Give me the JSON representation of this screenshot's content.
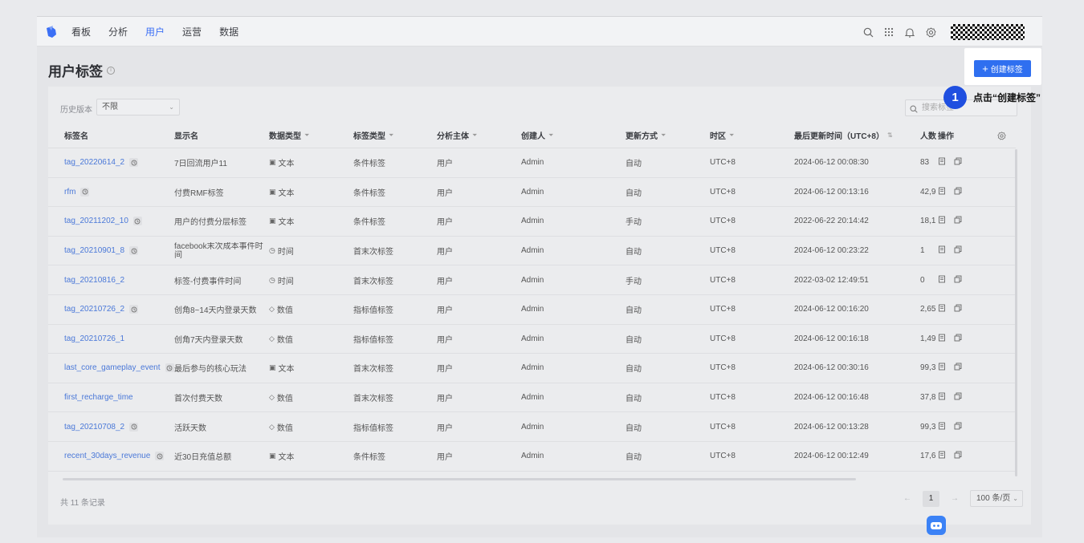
{
  "nav": {
    "items": [
      "看板",
      "分析",
      "用户",
      "运营",
      "数据"
    ],
    "active_index": 2
  },
  "page": {
    "title": "用户标签",
    "create_button": "创建标签"
  },
  "toolbar": {
    "history_label": "历史版本",
    "history_value": "不限",
    "search_placeholder": "搜索标签"
  },
  "table": {
    "headers": [
      "标签名",
      "显示名",
      "数据类型",
      "标签类型",
      "分析主体",
      "创建人",
      "更新方式",
      "时区",
      "最后更新时间（UTC+8）",
      "人数",
      "操作"
    ],
    "rows": [
      {
        "name": "tag_20220614_2",
        "history": true,
        "display": "7日回流用户11",
        "dtype": "文本",
        "dicon": "text",
        "ttype": "条件标签",
        "subject": "用户",
        "creator": "Admin",
        "update": "自动",
        "tz": "UTC+8",
        "time": "2024-06-12 00:08:30",
        "count": "83"
      },
      {
        "name": "rfm",
        "history": true,
        "display": "付费RMF标签",
        "dtype": "文本",
        "dicon": "text",
        "ttype": "条件标签",
        "subject": "用户",
        "creator": "Admin",
        "update": "自动",
        "tz": "UTC+8",
        "time": "2024-06-12 00:13:16",
        "count": "42,9"
      },
      {
        "name": "tag_20211202_10",
        "history": true,
        "display": "用户的付费分层标签",
        "dtype": "文本",
        "dicon": "text",
        "ttype": "条件标签",
        "subject": "用户",
        "creator": "Admin",
        "update": "手动",
        "tz": "UTC+8",
        "time": "2022-06-22 20:14:42",
        "count": "18,1"
      },
      {
        "name": "tag_20210901_8",
        "history": true,
        "display": "facebook末次成本事件时间",
        "dtype": "时间",
        "dicon": "time",
        "ttype": "首末次标签",
        "subject": "用户",
        "creator": "Admin",
        "update": "自动",
        "tz": "UTC+8",
        "time": "2024-06-12 00:23:22",
        "count": "1"
      },
      {
        "name": "tag_20210816_2",
        "history": false,
        "display": "标签-付费事件时间",
        "dtype": "时间",
        "dicon": "time",
        "ttype": "首末次标签",
        "subject": "用户",
        "creator": "Admin",
        "update": "手动",
        "tz": "UTC+8",
        "time": "2022-03-02 12:49:51",
        "count": "0"
      },
      {
        "name": "tag_20210726_2",
        "history": true,
        "display": "创角8~14天内登录天数",
        "dtype": "数值",
        "dicon": "num",
        "ttype": "指标值标签",
        "subject": "用户",
        "creator": "Admin",
        "update": "自动",
        "tz": "UTC+8",
        "time": "2024-06-12 00:16:20",
        "count": "2,65"
      },
      {
        "name": "tag_20210726_1",
        "history": false,
        "display": "创角7天内登录天数",
        "dtype": "数值",
        "dicon": "num",
        "ttype": "指标值标签",
        "subject": "用户",
        "creator": "Admin",
        "update": "自动",
        "tz": "UTC+8",
        "time": "2024-06-12 00:16:18",
        "count": "1,49"
      },
      {
        "name": "last_core_gameplay_event",
        "history": true,
        "display": "最后参与的核心玩法",
        "dtype": "文本",
        "dicon": "text",
        "ttype": "首末次标签",
        "subject": "用户",
        "creator": "Admin",
        "update": "自动",
        "tz": "UTC+8",
        "time": "2024-06-12 00:30:16",
        "count": "99,3"
      },
      {
        "name": "first_recharge_time",
        "history": false,
        "display": "首次付费天数",
        "dtype": "数值",
        "dicon": "num",
        "ttype": "首末次标签",
        "subject": "用户",
        "creator": "Admin",
        "update": "自动",
        "tz": "UTC+8",
        "time": "2024-06-12 00:16:48",
        "count": "37,8"
      },
      {
        "name": "tag_20210708_2",
        "history": true,
        "display": "活跃天数",
        "dtype": "数值",
        "dicon": "num",
        "ttype": "指标值标签",
        "subject": "用户",
        "creator": "Admin",
        "update": "自动",
        "tz": "UTC+8",
        "time": "2024-06-12 00:13:28",
        "count": "99,3"
      },
      {
        "name": "recent_30days_revenue",
        "history": true,
        "display": "近30日充值总额",
        "dtype": "文本",
        "dicon": "text",
        "ttype": "条件标签",
        "subject": "用户",
        "creator": "Admin",
        "update": "自动",
        "tz": "UTC+8",
        "time": "2024-06-12 00:12:49",
        "count": "17,6"
      }
    ]
  },
  "footer": {
    "total": "共 11 条记录",
    "current_page": "1",
    "page_size": "100 条/页"
  },
  "guide": {
    "step": "1",
    "text": "点击“创建标签”"
  }
}
